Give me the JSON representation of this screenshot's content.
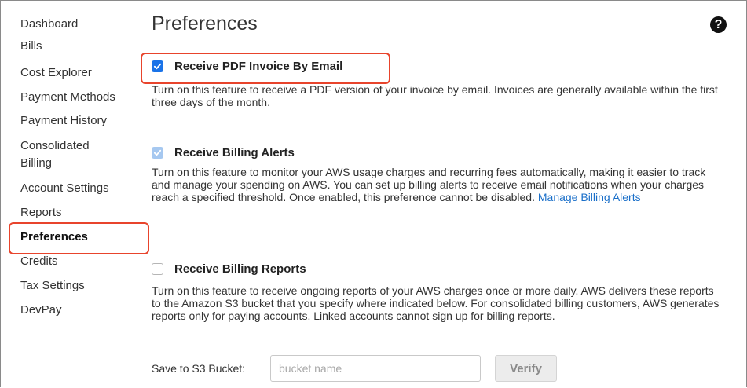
{
  "sidebar": {
    "items": [
      {
        "label": "Dashboard"
      },
      {
        "label": "Bills"
      },
      {
        "label": "Cost Explorer"
      },
      {
        "label": "Payment Methods"
      },
      {
        "label": "Payment History"
      },
      {
        "label": "Consolidated",
        "label2": "Billing"
      },
      {
        "label": "Account Settings"
      },
      {
        "label": "Reports"
      },
      {
        "label": "Preferences",
        "active": true
      },
      {
        "label": "Credits"
      },
      {
        "label": "Tax Settings"
      },
      {
        "label": "DevPay"
      }
    ]
  },
  "page": {
    "title": "Preferences",
    "help_icon": "?"
  },
  "preferences": {
    "pdf_invoice": {
      "label": "Receive PDF Invoice By Email",
      "checked": true,
      "description": "Turn on this feature to receive a PDF version of your invoice by email. Invoices are generally available within the first three days of the month."
    },
    "billing_alerts": {
      "label": "Receive Billing Alerts",
      "checked": true,
      "disabled": true,
      "description": "Turn on this feature to monitor your AWS usage charges and recurring fees automatically, making it easier to track and manage your spending on AWS. You can set up billing alerts to receive email notifications when your charges reach a specified threshold. Once enabled, this preference cannot be disabled.",
      "link_text": "Manage Billing Alerts"
    },
    "billing_reports": {
      "label": "Receive Billing Reports",
      "checked": false,
      "description": "Turn on this feature to receive ongoing reports of your AWS charges once or more daily. AWS delivers these reports to the Amazon S3 bucket that you specify where indicated below. For consolidated billing customers, AWS generates reports only for paying accounts. Linked accounts cannot sign up for billing reports."
    }
  },
  "s3": {
    "label": "Save to S3 Bucket:",
    "placeholder": "bucket name",
    "verify_label": "Verify"
  },
  "colors": {
    "accent": "#1a73e8",
    "highlight": "#e8442c",
    "link": "#1a6fc9"
  }
}
